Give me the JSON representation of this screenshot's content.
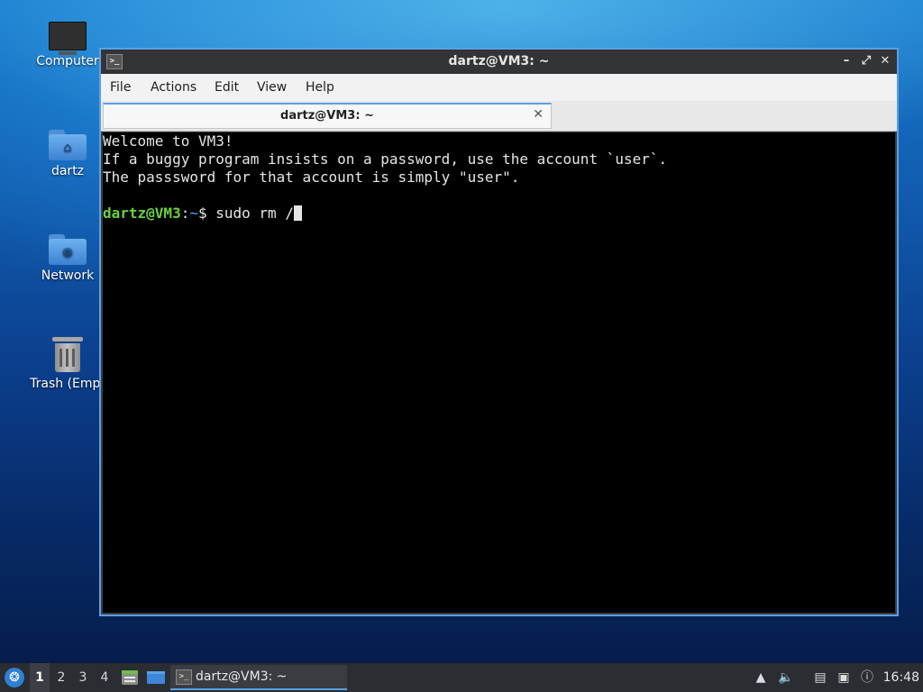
{
  "desktop": {
    "icons": [
      {
        "label": "Computer",
        "icon": "monitor-icon"
      },
      {
        "label": "dartz",
        "icon": "home-folder-icon"
      },
      {
        "label": "Network",
        "icon": "network-folder-icon"
      },
      {
        "label": "Trash (Empt",
        "icon": "trash-icon"
      }
    ]
  },
  "window": {
    "title": "dartz@VM3: ~",
    "controls": {
      "minimize": "–",
      "maximize": "⤢",
      "close": "✕"
    },
    "menu": [
      "File",
      "Actions",
      "Edit",
      "View",
      "Help"
    ],
    "tab": {
      "title": "dartz@VM3: ~",
      "close": "✕"
    },
    "terminal": {
      "lines": [
        "Welcome to VM3!",
        "If a buggy program insists on a password, use the account `user`.",
        "The passsword for that account is simply \"user\"."
      ],
      "prompt_user": "dartz@VM3",
      "prompt_sep": ":",
      "prompt_path": "~",
      "prompt_symbol": "$ ",
      "command": "sudo rm /"
    }
  },
  "taskbar": {
    "workspaces": [
      "1",
      "2",
      "3",
      "4"
    ],
    "active_workspace": "1",
    "task_label": "dartz@VM3: ~",
    "clock": "16:48"
  },
  "colors": {
    "accent": "#5aa0e8",
    "prompt_user": "#6ad13f",
    "prompt_path": "#4aa3ff",
    "terminal_bg": "#000000"
  }
}
